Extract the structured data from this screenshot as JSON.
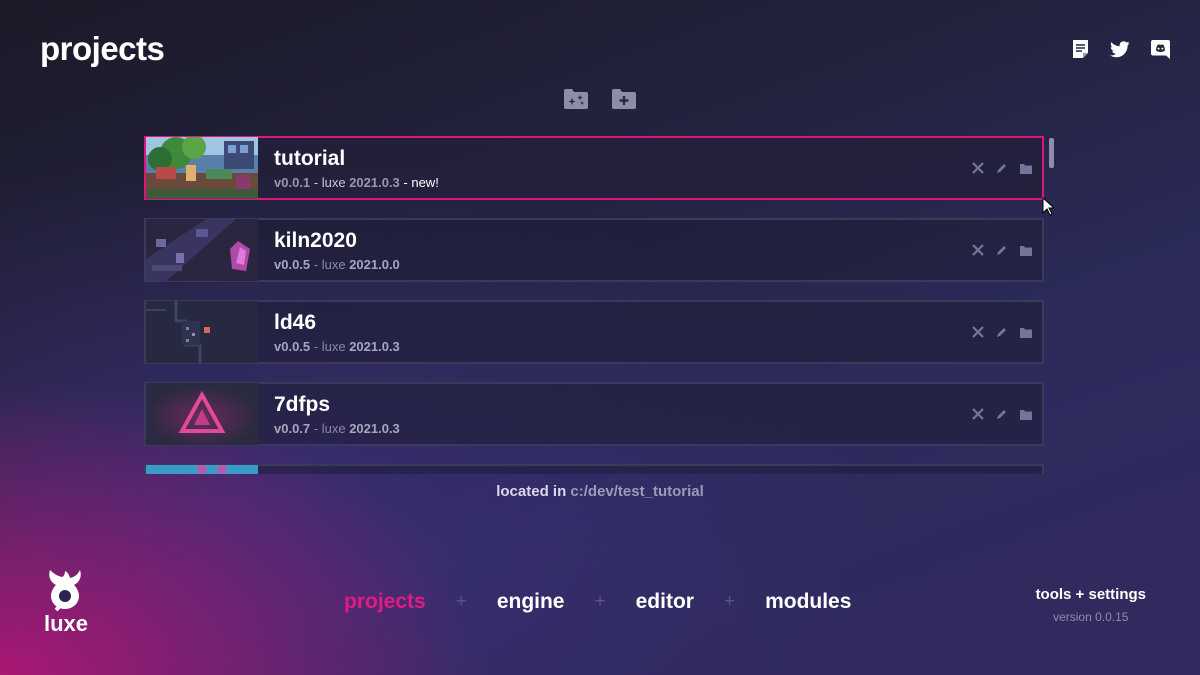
{
  "header": {
    "title": "projects",
    "icons": [
      "notes-icon",
      "twitter-icon",
      "discord-icon"
    ]
  },
  "actions": {
    "icons": [
      "new-project-from-template-icon",
      "add-project-folder-icon"
    ]
  },
  "projects": [
    {
      "name": "tutorial",
      "version_label": "v",
      "version": "0.0.1",
      "sep1": " - ",
      "luxe_label": "luxe ",
      "luxe_version": "2021.0.3",
      "extra": " - new!",
      "selected": true
    },
    {
      "name": "kiln2020",
      "version_label": "v",
      "version": "0.0.5",
      "sep1": " - ",
      "luxe_label": "luxe ",
      "luxe_version": "2021.0.0",
      "extra": "",
      "selected": false
    },
    {
      "name": "ld46",
      "version_label": "v",
      "version": "0.0.5",
      "sep1": " - ",
      "luxe_label": "luxe ",
      "luxe_version": "2021.0.3",
      "extra": "",
      "selected": false
    },
    {
      "name": "7dfps",
      "version_label": "v",
      "version": "0.0.7",
      "sep1": " - ",
      "luxe_label": "luxe ",
      "luxe_version": "2021.0.3",
      "extra": "",
      "selected": false
    }
  ],
  "location": {
    "prefix": "located in ",
    "path": "c:/dev/test_tutorial"
  },
  "logo": {
    "text": "luxe"
  },
  "nav": {
    "items": [
      "projects",
      "engine",
      "editor",
      "modules"
    ],
    "separator": "+",
    "active": "projects"
  },
  "tools": {
    "label": "tools + settings",
    "version": "version 0.0.15"
  },
  "colors": {
    "accent": "#e21a85",
    "background": "#23233f",
    "row_border": "#3b3a5e"
  }
}
